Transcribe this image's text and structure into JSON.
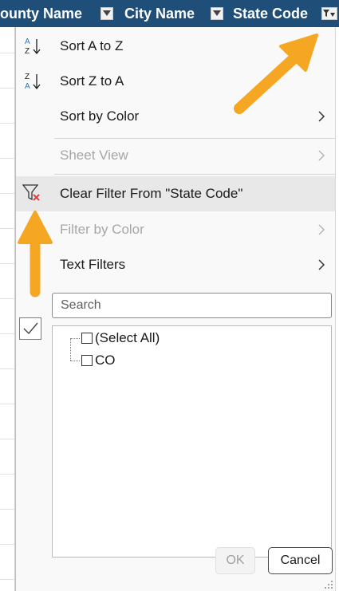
{
  "header": {
    "columns": [
      {
        "label": "ounty Name"
      },
      {
        "label": "City Name"
      },
      {
        "label": "State Code"
      }
    ]
  },
  "menu": {
    "sort_az": "Sort A to Z",
    "sort_za": "Sort Z to A",
    "sort_by_color": "Sort by Color",
    "sheet_view": "Sheet View",
    "clear_filter": "Clear Filter From \"State Code\"",
    "filter_by_color": "Filter by Color",
    "text_filters": "Text Filters"
  },
  "search": {
    "placeholder": "Search"
  },
  "list": {
    "items": [
      {
        "label": "(Select All)",
        "checked": false
      },
      {
        "label": "CO",
        "checked": false
      }
    ]
  },
  "buttons": {
    "ok": "OK",
    "cancel": "Cancel"
  },
  "colors": {
    "header_bg": "#1f4e79",
    "annotation_arrow": "#f5a623",
    "clear_filter_x": "#e04040"
  },
  "icons": {
    "sort_az": "sort-ascending-icon",
    "sort_za": "sort-descending-icon",
    "clear_filter": "clear-filter-icon",
    "submenu": "chevron-right-icon"
  }
}
